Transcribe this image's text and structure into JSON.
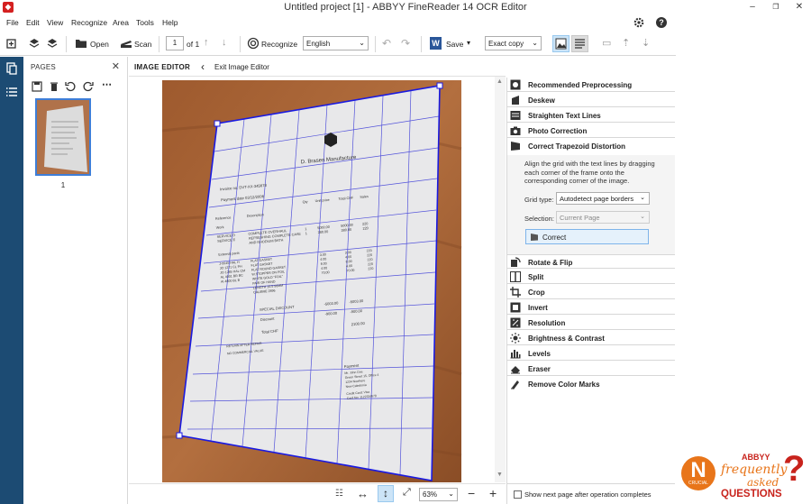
{
  "window": {
    "title": "Untitled project [1] - ABBYY FineReader 14 OCR Editor",
    "controls": [
      "–",
      "❐",
      "✕"
    ]
  },
  "menu": [
    "File",
    "Edit",
    "View",
    "Recognize",
    "Area",
    "Tools",
    "Help"
  ],
  "toolbar": {
    "open_label": "Open",
    "scan_label": "Scan",
    "page_number": "1",
    "page_of": "of 1",
    "recognize_label": "Recognize",
    "language": "English",
    "save_label": "Save",
    "save_format": "Exact copy"
  },
  "pages_panel": {
    "header": "PAGES",
    "page_number": "1"
  },
  "image_editor": {
    "title": "IMAGE EDITOR",
    "exit_label": "Exit Image Editor"
  },
  "document": {
    "company": "D. Brasen Manufacture",
    "invoice_no": "Invoice no. DVT-XX-345678",
    "payment_date": "Payment date 03/12/2006",
    "col_qty": "Qty",
    "col_unit": "Unit price",
    "col_total": "Total CHF",
    "col_sales": "Sales",
    "col_ref": "Reference",
    "col_desc": "Description",
    "row_work": "Work",
    "row_service": "SERVICE D",
    "row_service2": "SERVICE E",
    "desc1": "COMPLETE OVERHAUL",
    "desc2": "REFRESHING COMPLETE CASE",
    "desc3": "AND RHODIUM BATH",
    "ext_parts": "External parts",
    "part1": "J-0045 HAL H",
    "part2": "JO 1271 CL PH",
    "part3": "JO 1285 HAL CM",
    "part4": "AL 4001 BR BC",
    "part5": "AI 4800 BL B",
    "pdesc1": "FLAT GASKET",
    "pdesc2": "FLAT GASKET",
    "pdesc3": "FLAT ROUND GASKET",
    "pdesc4": "W.STOPPER ON FOIL",
    "pdesc5": "WHITE GOLD \"FOIL\"",
    "pdesc6": "PAIR OF HAND",
    "pdesc7": "LENGTH 10.5 50MM",
    "pdesc8": "CALIBRE 2896",
    "special": "SPECIAL DISCOUNT",
    "special_amt": "-5003.00",
    "special_amt2": "-5003.00",
    "discount": "Discount",
    "discount_amt": "-900.00",
    "discount_amt2": "-900.00",
    "total": "Total CHF",
    "total_amt": "2100.00",
    "return": "RETURN AFTER REPAIR",
    "no_commercial": "NO COMMERCIAL VALUE",
    "payment": "Payment",
    "pay1": "Mr. John Doe",
    "pay2": "Green Street 15, Office 4",
    "pay3": "1234 Nowhere",
    "pay4": "New Caledonia",
    "pay5": "Credit Card: Visa",
    "pay6": "Card No: 1122334678",
    "amt1": "5000.00",
    "amt2": "380.00",
    "amt3": "5000.00",
    "amt4": "380.00",
    "sales1": "220",
    "sales2": "220",
    "q1": "1",
    "q2": "1",
    "p1": "3.00",
    "p2": "4.00",
    "p3": "6.00",
    "p4": "4.00",
    "p5": "70.00",
    "t1": "3.00",
    "t2": "4.00",
    "t3": "6.00",
    "t4": "4.00",
    "t5": "70.00",
    "s1": "220",
    "s2": "220",
    "s3": "220",
    "s4": "220",
    "s5": "220"
  },
  "bottom": {
    "zoom": "63%"
  },
  "tools": [
    {
      "label": "Recommended Preprocessing",
      "icon": "preprocess-icon"
    },
    {
      "label": "Deskew",
      "icon": "deskew-icon"
    },
    {
      "label": "Straighten Text Lines",
      "icon": "straighten-icon"
    },
    {
      "label": "Photo Correction",
      "icon": "camera-icon"
    },
    {
      "label": "Correct Trapezoid Distortion",
      "icon": "trapezoid-icon"
    }
  ],
  "trapezoid": {
    "description": "Align the grid with the text lines by dragging each corner of the frame onto the corresponding corner of the image.",
    "grid_type_label": "Grid type:",
    "grid_type_value": "Autodetect page borders",
    "selection_label": "Selection:",
    "selection_value": "Current Page",
    "correct_label": "Correct"
  },
  "tools2": [
    {
      "label": "Rotate & Flip",
      "icon": "rotate-icon"
    },
    {
      "label": "Split",
      "icon": "split-icon"
    },
    {
      "label": "Crop",
      "icon": "crop-icon"
    },
    {
      "label": "Invert",
      "icon": "invert-icon"
    },
    {
      "label": "Resolution",
      "icon": "resolution-icon"
    },
    {
      "label": "Brightness & Contrast",
      "icon": "brightness-icon"
    },
    {
      "label": "Levels",
      "icon": "levels-icon"
    },
    {
      "label": "Eraser",
      "icon": "eraser-icon"
    },
    {
      "label": "Remove Color Marks",
      "icon": "remove-color-icon"
    }
  ],
  "footer": {
    "show_next_label": "Show next page after operation completes"
  },
  "faq_logo": {
    "brand": "ABBYY",
    "line1": "frequently",
    "line2": "asked",
    "line3": "QUESTIONS",
    "badge": "N",
    "badge_sub": "CRUCIAL"
  },
  "colors": {
    "rail": "#1c4b73",
    "grid": "#3a3ad8",
    "selection": "#3e7ed8",
    "faq_orange": "#e8751a",
    "faq_red": "#c8231c"
  }
}
